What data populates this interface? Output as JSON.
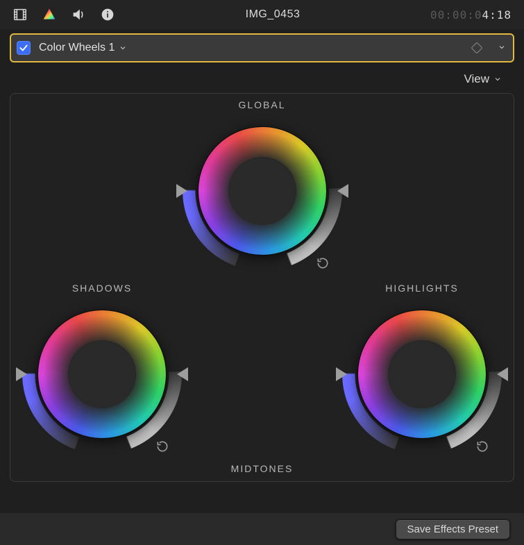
{
  "header": {
    "clip_title": "IMG_0453",
    "timecode_dim": "00:00:0",
    "timecode_lit": "4:18",
    "icons": [
      "film-icon",
      "color-prism-icon",
      "volume-icon",
      "info-icon"
    ]
  },
  "correction_bar": {
    "enabled": true,
    "name": "Color Wheels 1"
  },
  "view_menu": {
    "label": "View"
  },
  "wheels": {
    "global": {
      "label": "GLOBAL",
      "puck_style": "dotted"
    },
    "shadows": {
      "label": "SHADOWS",
      "puck_style": "outline"
    },
    "highlights": {
      "label": "HIGHLIGHTS",
      "puck_style": "filled"
    },
    "midtones": {
      "label": "MIDTONES"
    }
  },
  "footer": {
    "save_preset_label": "Save Effects Preset"
  },
  "colors": {
    "selection_border": "#e0b93e",
    "checkbox_bg": "#3b6ef4"
  }
}
